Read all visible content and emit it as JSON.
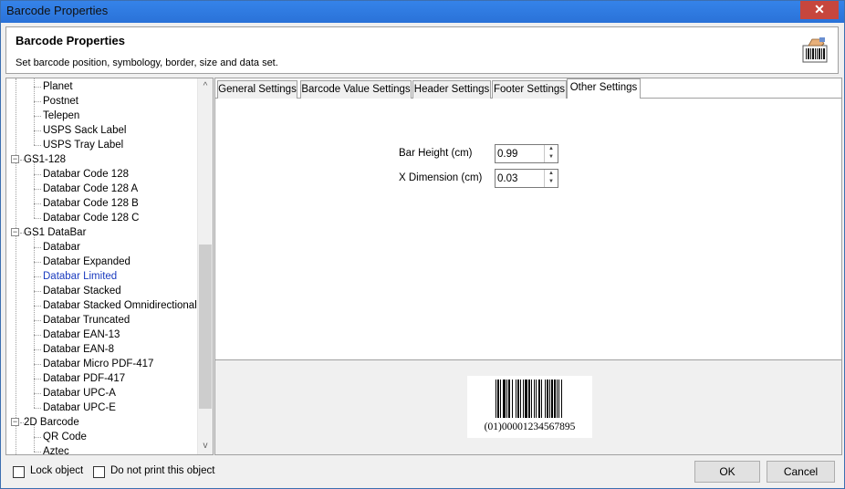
{
  "window": {
    "title": "Barcode Properties",
    "close_glyph": "✕"
  },
  "header": {
    "title": "Barcode Properties",
    "subtitle": "Set barcode position, symbology, border, size and data set.",
    "icon": "barcode-hand-icon"
  },
  "tree": {
    "items": [
      {
        "label": "Planet",
        "level": 1
      },
      {
        "label": "Postnet",
        "level": 1
      },
      {
        "label": "Telepen",
        "level": 1
      },
      {
        "label": "USPS Sack Label",
        "level": 1
      },
      {
        "label": "USPS Tray Label",
        "level": 1
      },
      {
        "label": "GS1-128",
        "level": 0
      },
      {
        "label": "Databar Code 128",
        "level": 1
      },
      {
        "label": "Databar Code 128 A",
        "level": 1
      },
      {
        "label": "Databar Code 128 B",
        "level": 1
      },
      {
        "label": "Databar Code 128 C",
        "level": 1
      },
      {
        "label": "GS1 DataBar",
        "level": 0
      },
      {
        "label": "Databar",
        "level": 1
      },
      {
        "label": "Databar Expanded",
        "level": 1
      },
      {
        "label": "Databar Limited",
        "level": 1,
        "selected": true
      },
      {
        "label": "Databar Stacked",
        "level": 1
      },
      {
        "label": "Databar Stacked Omnidirectional",
        "level": 1
      },
      {
        "label": "Databar Truncated",
        "level": 1
      },
      {
        "label": "Databar EAN-13",
        "level": 1
      },
      {
        "label": "Databar EAN-8",
        "level": 1
      },
      {
        "label": "Databar Micro PDF-417",
        "level": 1
      },
      {
        "label": "Databar PDF-417",
        "level": 1
      },
      {
        "label": "Databar UPC-A",
        "level": 1
      },
      {
        "label": "Databar UPC-E",
        "level": 1
      },
      {
        "label": "2D Barcode",
        "level": 0
      },
      {
        "label": "QR Code",
        "level": 1
      },
      {
        "label": "Aztec",
        "level": 1
      }
    ],
    "toggle_glyph": "−",
    "scroll_up_glyph": "^",
    "scroll_down_glyph": "v"
  },
  "tabs": [
    {
      "label": "General Settings"
    },
    {
      "label": "Barcode Value Settings"
    },
    {
      "label": "Header Settings"
    },
    {
      "label": "Footer Settings"
    },
    {
      "label": "Other Settings",
      "active": true
    }
  ],
  "settings": {
    "bar_height_label": "Bar Height (cm)",
    "bar_height_value": "0.99",
    "x_dimension_label": "X Dimension (cm)",
    "x_dimension_value": "0.03",
    "spin_up_glyph": "▲",
    "spin_down_glyph": "▼"
  },
  "preview": {
    "barcode_text": "(01)00001234567895"
  },
  "footer": {
    "lock_label": "Lock object",
    "lock_checked": false,
    "no_print_label": "Do not print this object",
    "no_print_checked": false,
    "ok_label": "OK",
    "cancel_label": "Cancel"
  }
}
